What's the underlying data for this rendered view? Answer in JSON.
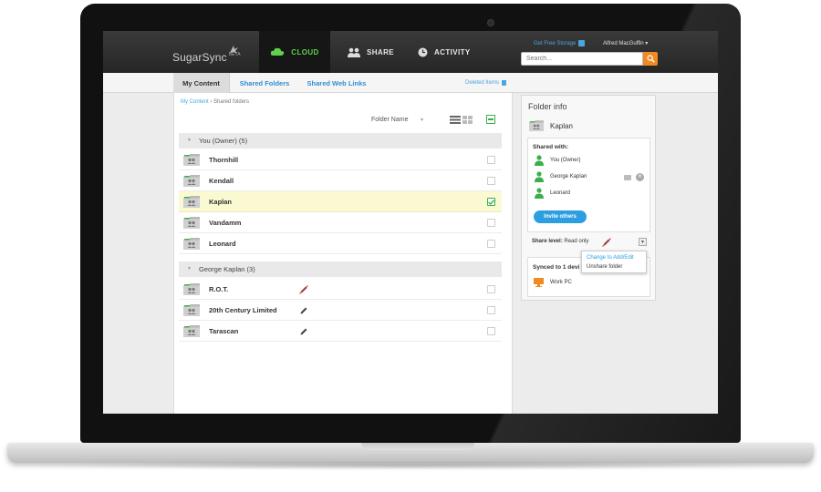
{
  "app": {
    "logo_text": "SugarSync",
    "logo_badge": "BETA"
  },
  "header": {
    "nav": [
      {
        "label": "CLOUD",
        "icon": "cloud-icon"
      },
      {
        "label": "SHARE",
        "icon": "people-icon"
      },
      {
        "label": "ACTIVITY",
        "icon": "clock-icon"
      }
    ],
    "get_free_storage": "Get Free Storage",
    "user_name": "Alfred MacGuffin ▾",
    "search_placeholder": "Search..."
  },
  "tabs": [
    {
      "label": "My Content",
      "active": true
    },
    {
      "label": "Shared Folders",
      "active": false
    },
    {
      "label": "Shared Web Links",
      "active": false
    }
  ],
  "deleted_items": "Deleted Items",
  "breadcrumb": {
    "root": "My Content",
    "separator": "›",
    "current": "Shared folders"
  },
  "sort": {
    "label": "Folder Name",
    "caret": "▾"
  },
  "groups": [
    {
      "header": "You (Owner) (5)",
      "rows": [
        {
          "name": "Thornhill",
          "checked": false,
          "highlighted": false,
          "permission": null
        },
        {
          "name": "Kendall",
          "checked": false,
          "highlighted": false,
          "permission": null
        },
        {
          "name": "Kaplan",
          "checked": true,
          "highlighted": true,
          "permission": null
        },
        {
          "name": "Vandamm",
          "checked": false,
          "highlighted": false,
          "permission": null
        },
        {
          "name": "Leonard",
          "checked": false,
          "highlighted": false,
          "permission": null
        }
      ]
    },
    {
      "header": "George Kaplan (3)",
      "rows": [
        {
          "name": "R.O.T.",
          "checked": false,
          "highlighted": false,
          "permission": "read-only-pencil-icon"
        },
        {
          "name": "20th Century Limited",
          "checked": false,
          "highlighted": false,
          "permission": "edit-pencil-icon"
        },
        {
          "name": "Tarascan",
          "checked": false,
          "highlighted": false,
          "permission": "edit-pencil-icon"
        }
      ]
    }
  ],
  "folder_info": {
    "title": "Folder info",
    "folder_name": "Kaplan",
    "shared_with_label": "Shared with:",
    "people": [
      {
        "name": "You (Owner)"
      },
      {
        "name": "George Kaplan"
      },
      {
        "name": "Leonard"
      }
    ],
    "invite_label": "Invite others",
    "share_level_label": "Share level:",
    "share_level_value": "Read only",
    "synced_label": "Synced to 1 devi",
    "device_name": "Work PC"
  },
  "share_level_menu": [
    "Change to Add/Edit",
    "Unshare folder"
  ],
  "colors": {
    "accent_blue": "#2d9fe0",
    "cloud_green": "#5fd14a",
    "search_orange": "#f08a24",
    "highlight_yellow": "#fbf9d1",
    "person_green": "#3bb04a"
  }
}
